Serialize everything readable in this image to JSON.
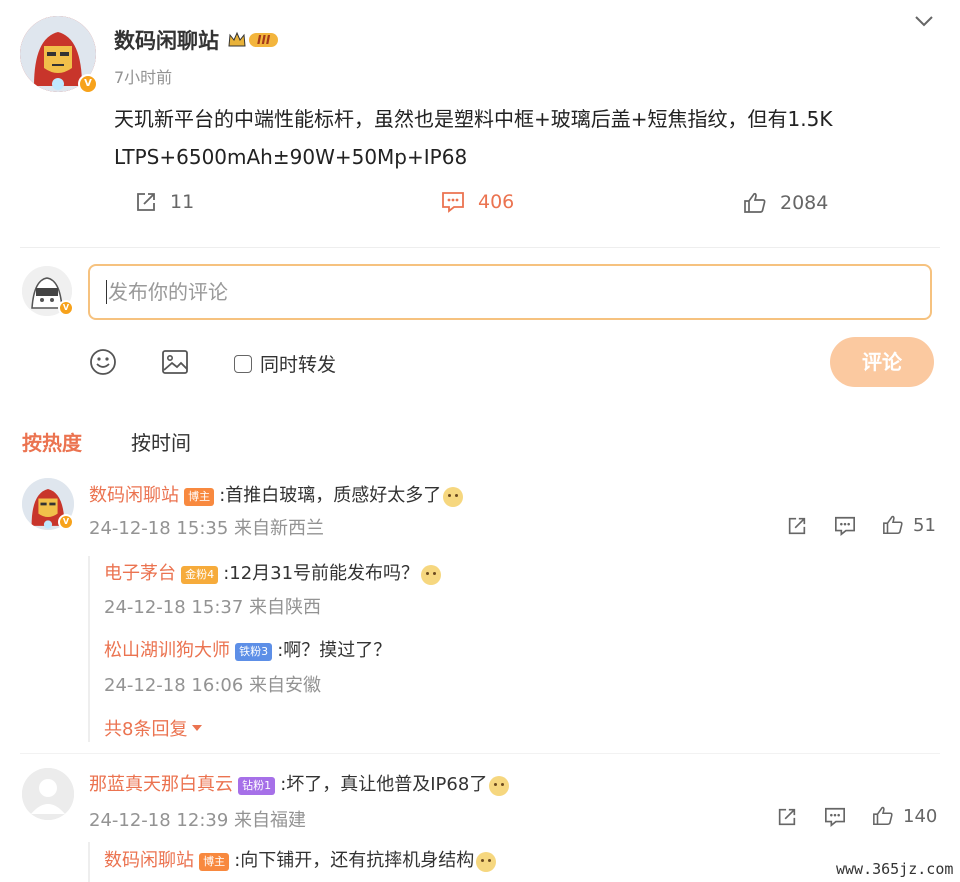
{
  "post": {
    "author": "数码闲聊站",
    "level_badge": "III",
    "time": "7小时前",
    "text_line1": "天玑新平台的中端性能标杆，虽然也是塑料中框+玻璃后盖+短焦指纹，但有1.5K",
    "text_line2": "LTPS+6500mAh±90W+50Mp+IP68",
    "shares": "11",
    "comments": "406",
    "likes": "2084"
  },
  "composer": {
    "placeholder": "发布你的评论",
    "repost_label": "同时转发",
    "submit_label": "评论"
  },
  "sort": {
    "hot": "按热度",
    "time": "按时间"
  },
  "comments": [
    {
      "author": "数码闲聊站",
      "tag": "博主",
      "text": ":首推白玻璃，质感好太多了",
      "meta": "24-12-18 15:35 来自新西兰",
      "likes": "51",
      "replies": [
        {
          "author": "电子茅台",
          "tag": "金粉4",
          "text": ":12月31号前能发布吗？",
          "meta": "24-12-18 15:37 来自陕西"
        },
        {
          "author": "松山湖训狗大师",
          "tag": "铁粉3",
          "text": ":啊？摸过了？",
          "meta": "24-12-18 16:06 来自安徽"
        }
      ],
      "more_replies": "共8条回复"
    },
    {
      "author": "那蓝真天那白真云",
      "tag": "钻粉1",
      "text": ":坏了，真让他普及IP68了",
      "meta": "24-12-18 12:39 来自福建",
      "likes": "140",
      "replies": [
        {
          "author": "数码闲聊站",
          "tag": "博主",
          "text": ":向下铺开，还有抗摔机身结构"
        }
      ]
    }
  ],
  "watermark": "www.365jz.com",
  "colors": {
    "accent": "#eb7350",
    "border": "#f6c27f",
    "submit_bg": "#fbc9a0"
  }
}
